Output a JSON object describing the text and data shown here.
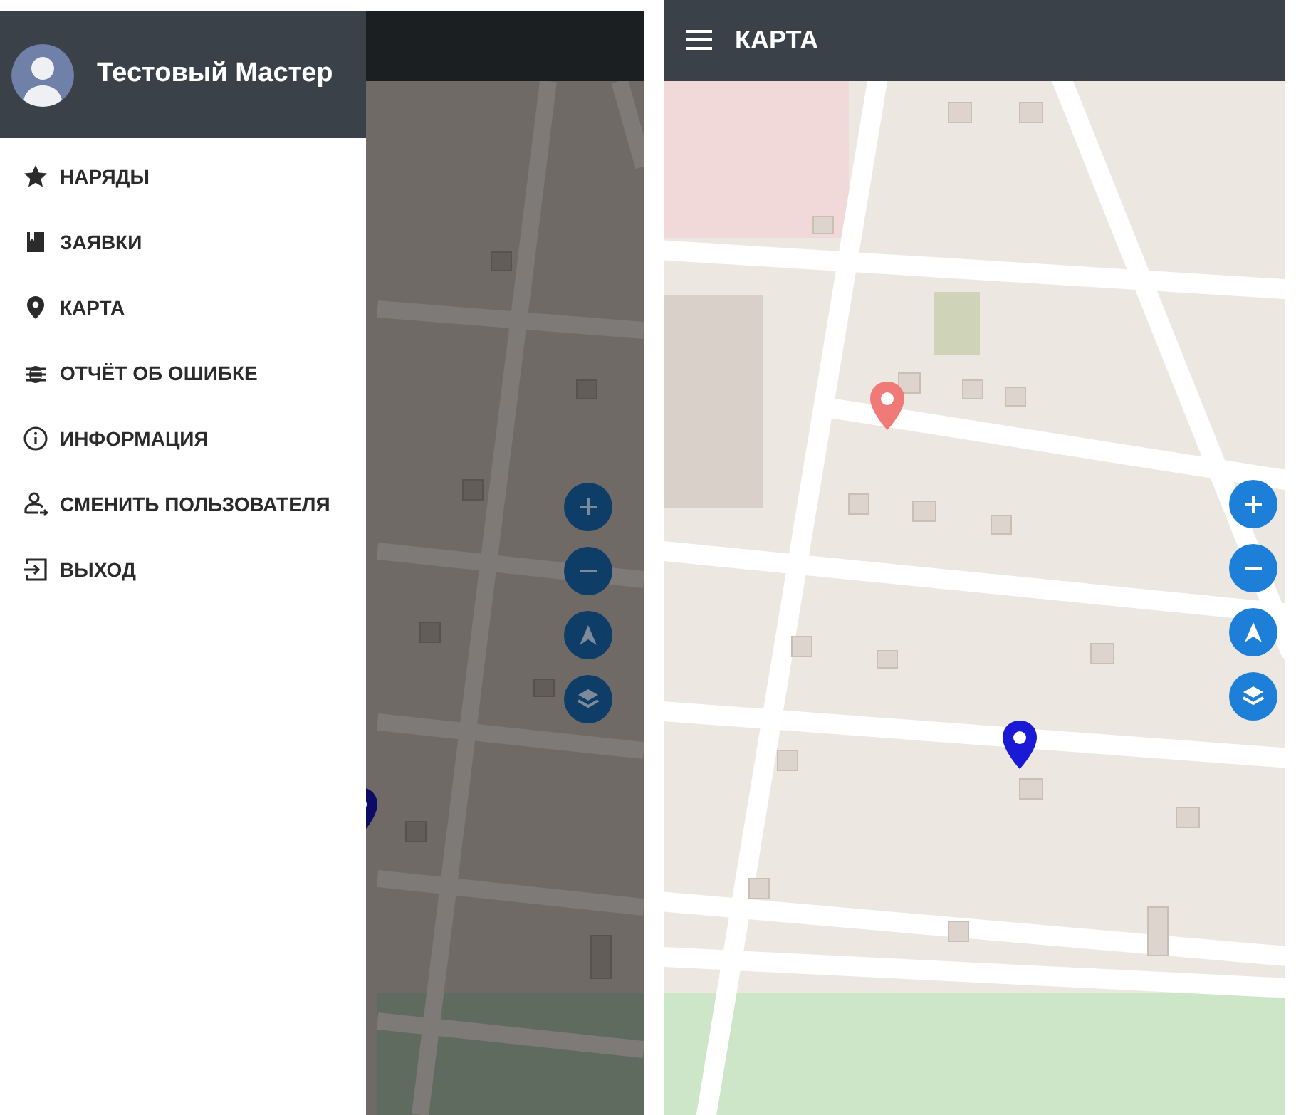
{
  "drawer": {
    "user_name": "Тестовый Мастер",
    "items": [
      {
        "label": "НАРЯДЫ",
        "kind": "star"
      },
      {
        "label": "ЗАЯВКИ",
        "kind": "book"
      },
      {
        "label": "КАРТА",
        "kind": "pin"
      },
      {
        "label": "ОТЧЁТ ОБ ОШИБКЕ",
        "kind": "bug"
      },
      {
        "label": "ИНФОРМАЦИЯ",
        "kind": "info"
      },
      {
        "label": "СМЕНИТЬ ПОЛЬЗОВАТЕЛЯ",
        "kind": "switch-user"
      },
      {
        "label": "ВЫХОД",
        "kind": "exit"
      }
    ]
  },
  "map_screen": {
    "title": "КАРТА"
  }
}
